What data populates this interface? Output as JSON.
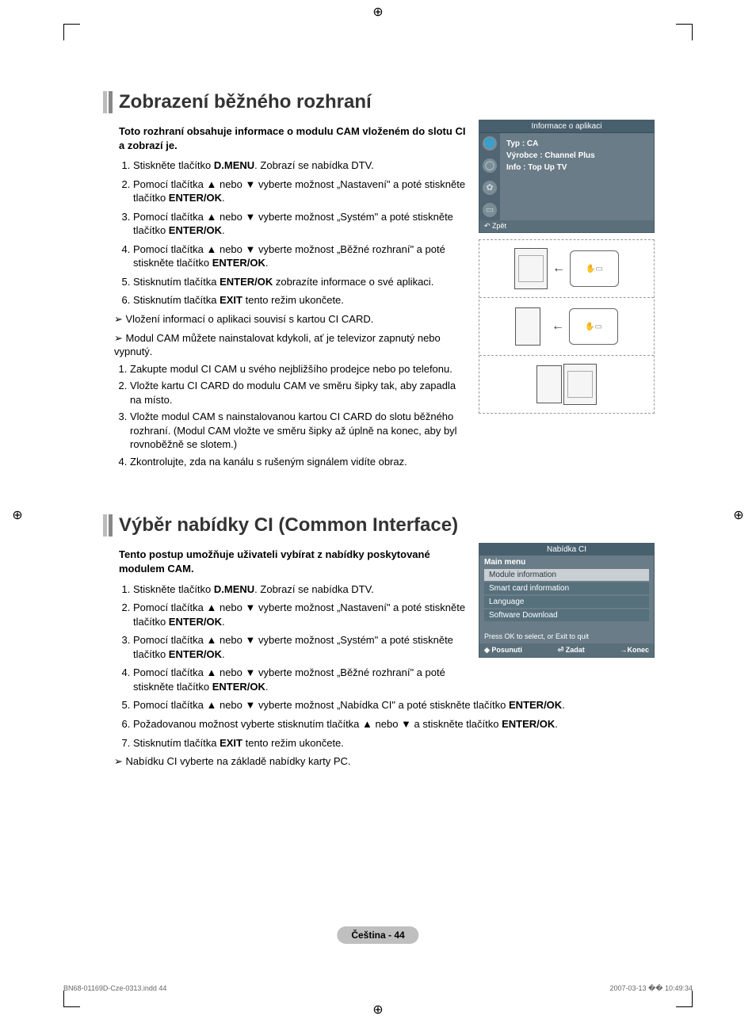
{
  "section1": {
    "title": "Zobrazení běžného rozhraní",
    "intro": "Toto rozhraní obsahuje informace o modulu CAM vloženém do slotu CI a zobrazí je.",
    "steps": [
      {
        "pre": "Stiskněte tlačítko ",
        "bold": "D.MENU",
        "post": ". Zobrazí se nabídka DTV."
      },
      {
        "text": "Pomocí tlačítka ▲ nebo ▼ vyberte možnost „Nastavení\" a poté stiskněte tlačítko ",
        "bold": "ENTER/OK",
        "post": "."
      },
      {
        "text": "Pomocí tlačítka ▲ nebo ▼ vyberte možnost „Systém\" a poté stiskněte tlačítko ",
        "bold": "ENTER/OK",
        "post": "."
      },
      {
        "text": "Pomocí tlačítka ▲ nebo ▼ vyberte možnost „Běžné rozhraní\" a poté stiskněte tlačítko ",
        "bold": "ENTER/OK",
        "post": "."
      },
      {
        "text": "Stisknutím tlačítka ",
        "bold": "ENTER/OK",
        "post": " zobrazíte informace o své aplikaci."
      },
      {
        "text": "Stisknutím tlačítka ",
        "bold": "EXIT",
        "post": " tento režim ukončete."
      }
    ],
    "notes": [
      "Vložení informací o aplikaci souvisí s kartou CI CARD.",
      "Modul CAM můžete nainstalovat kdykoli, ať je televizor zapnutý nebo vypnutý."
    ],
    "substeps": [
      "Zakupte modul CI CAM u svého nejbližšího prodejce nebo po telefonu.",
      "Vložte kartu CI CARD do modulu CAM ve směru šipky tak, aby zapadla na místo.",
      "Vložte modul CAM s nainstalovanou kartou CI CARD do slotu běžného rozhraní. (Modul CAM vložte ve směru šipky až úplně na konec, aby byl rovnoběžně se slotem.)",
      "Zkontrolujte, zda na kanálu s rušeným signálem vidíte obraz."
    ],
    "osd": {
      "title": "Informace o aplikaci",
      "line1": "Typ : CA",
      "line2": "Výrobce : Channel Plus",
      "line3": "Info : Top Up TV",
      "back": "Zpět"
    }
  },
  "section2": {
    "title": "Výběr nabídky CI (Common Interface)",
    "intro": "Tento postup umožňuje uživateli vybírat z nabídky poskytované modulem CAM.",
    "steps_top": [
      {
        "pre": "Stiskněte tlačítko ",
        "bold": "D.MENU",
        "post": ". Zobrazí se nabídka DTV."
      },
      {
        "text": "Pomocí tlačítka ▲ nebo ▼ vyberte možnost „Nastavení\" a poté stiskněte tlačítko ",
        "bold": "ENTER/OK",
        "post": "."
      },
      {
        "text": "Pomocí tlačítka ▲ nebo ▼ vyberte možnost „Systém\" a poté stiskněte tlačítko ",
        "bold": "ENTER/OK",
        "post": "."
      },
      {
        "text": "Pomocí tlačítka ▲ nebo ▼ vyberte možnost „Běžné rozhraní\" a poté stiskněte tlačítko ",
        "bold": "ENTER/OK",
        "post": "."
      }
    ],
    "steps_full": [
      {
        "text": "Pomocí tlačítka ▲ nebo ▼ vyberte možnost „Nabídka CI\" a poté stiskněte tlačítko ",
        "bold": "ENTER/OK",
        "post": "."
      },
      {
        "text": "Požadovanou možnost vyberte stisknutím tlačítka ▲ nebo ▼ a stiskněte tlačítko ",
        "bold": "ENTER/OK",
        "post": "."
      },
      {
        "text": "Stisknutím tlačítka ",
        "bold": "EXIT",
        "post": " tento režim ukončete."
      }
    ],
    "note": "Nabídku CI vyberte na základě nabídky karty PC.",
    "ci": {
      "title": "Nabídka CI",
      "main": "Main menu",
      "items": [
        "Module information",
        "Smart card information",
        "Language",
        "Software Download"
      ],
      "hint": "Press OK to select, or Exit to quit",
      "footer": {
        "move": "Posunutí",
        "enter": "Zadat",
        "exit": "Konec"
      }
    }
  },
  "pagelabel": "Čeština - 44",
  "footer": {
    "left": "BN68-01169D-Cze-0313.indd   44",
    "right": "2007-03-13   �� 10:49:34"
  }
}
